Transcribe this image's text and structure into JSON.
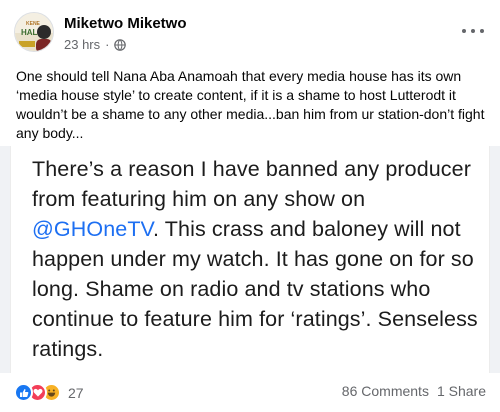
{
  "post": {
    "author": "Miketwo Miketwo",
    "time": "23 hrs",
    "separator": "·",
    "avatar_text_top": "KENE",
    "avatar_text_main": "HALL",
    "text": "One should tell Nana Aba Anamoah that every media house has its own ‘media house style’ to create content, if it is a shame to host Lutterodt it wouldn’t be a shame to any other media...ban him from ur station-don’t fight any body..."
  },
  "screenshot": {
    "text_before": "There’s a reason I have banned any producer from featuring him on any show on ",
    "handle": "@GHOneTV",
    "text_after": ". This crass and baloney will not happen under my watch. It has gone on for so long. Shame on radio and tv stations who continue to feature him for ‘ratings’. Senseless ratings."
  },
  "footer": {
    "reaction_count": "27",
    "comments": "86 Comments",
    "shares": "1 Share",
    "reactions": [
      "like-icon",
      "love-icon",
      "haha-icon"
    ]
  },
  "colors": {
    "link": "#1d6ff2",
    "like": "#1877f2",
    "love": "#f33e58",
    "haha": "#f7b125",
    "secondary_text": "#65676b"
  }
}
